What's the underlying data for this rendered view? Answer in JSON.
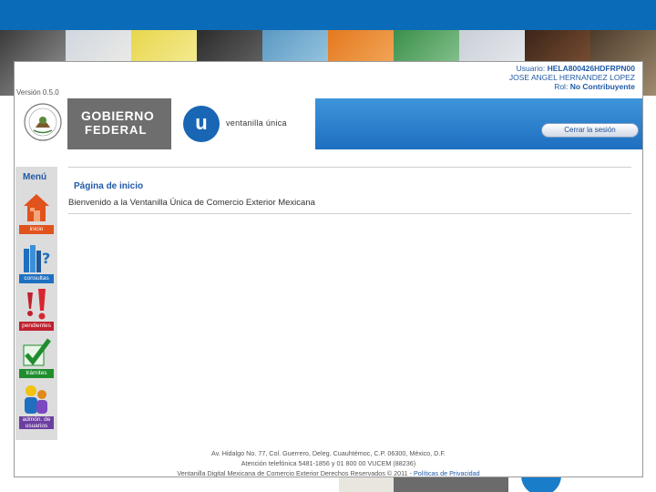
{
  "header": {
    "version": "Versión 0.5.0",
    "user_label": "Usuario:",
    "user_id": "HELA800426HDFRPN00",
    "user_name": "JOSE ANGEL HERNANDEZ LOPEZ",
    "role_label": "Rol:",
    "role_value": "No Contribuyente",
    "gob_line1": "GOBIERNO",
    "gob_line2": "FEDERAL",
    "vu_letter": "u",
    "vu_text": "ventanilla única",
    "logout_label": "Cerrar la sesión"
  },
  "menu": {
    "title": "Menú",
    "items": [
      {
        "label": "inicio"
      },
      {
        "label": "consultas"
      },
      {
        "label": "pendientes"
      },
      {
        "label": "trámites"
      },
      {
        "label": "admón. de usuarios"
      }
    ]
  },
  "content": {
    "title": "Página de inicio",
    "welcome": "Bienvenido a la Ventanilla Única de Comercio Exterior Mexicana"
  },
  "footer": {
    "line1": "Av. Hidalgo No. 77, Col. Guerrero, Deleg. Cuauhtémoc, C.P. 06300, México, D.F.",
    "line2": "Atención telefónica 5481-1856 y 01 800 00 VUCEM (88236)",
    "line3": "Ventanilla Digital Mexicana de Comercio Exterior Derechos Reservados © 2011 -",
    "policy_link": "Políticas de Privacidad"
  },
  "colors": {
    "accent": "#1f5aa6",
    "top_band": "#0a6bb8",
    "menu_bg": "#dcdcdc"
  }
}
